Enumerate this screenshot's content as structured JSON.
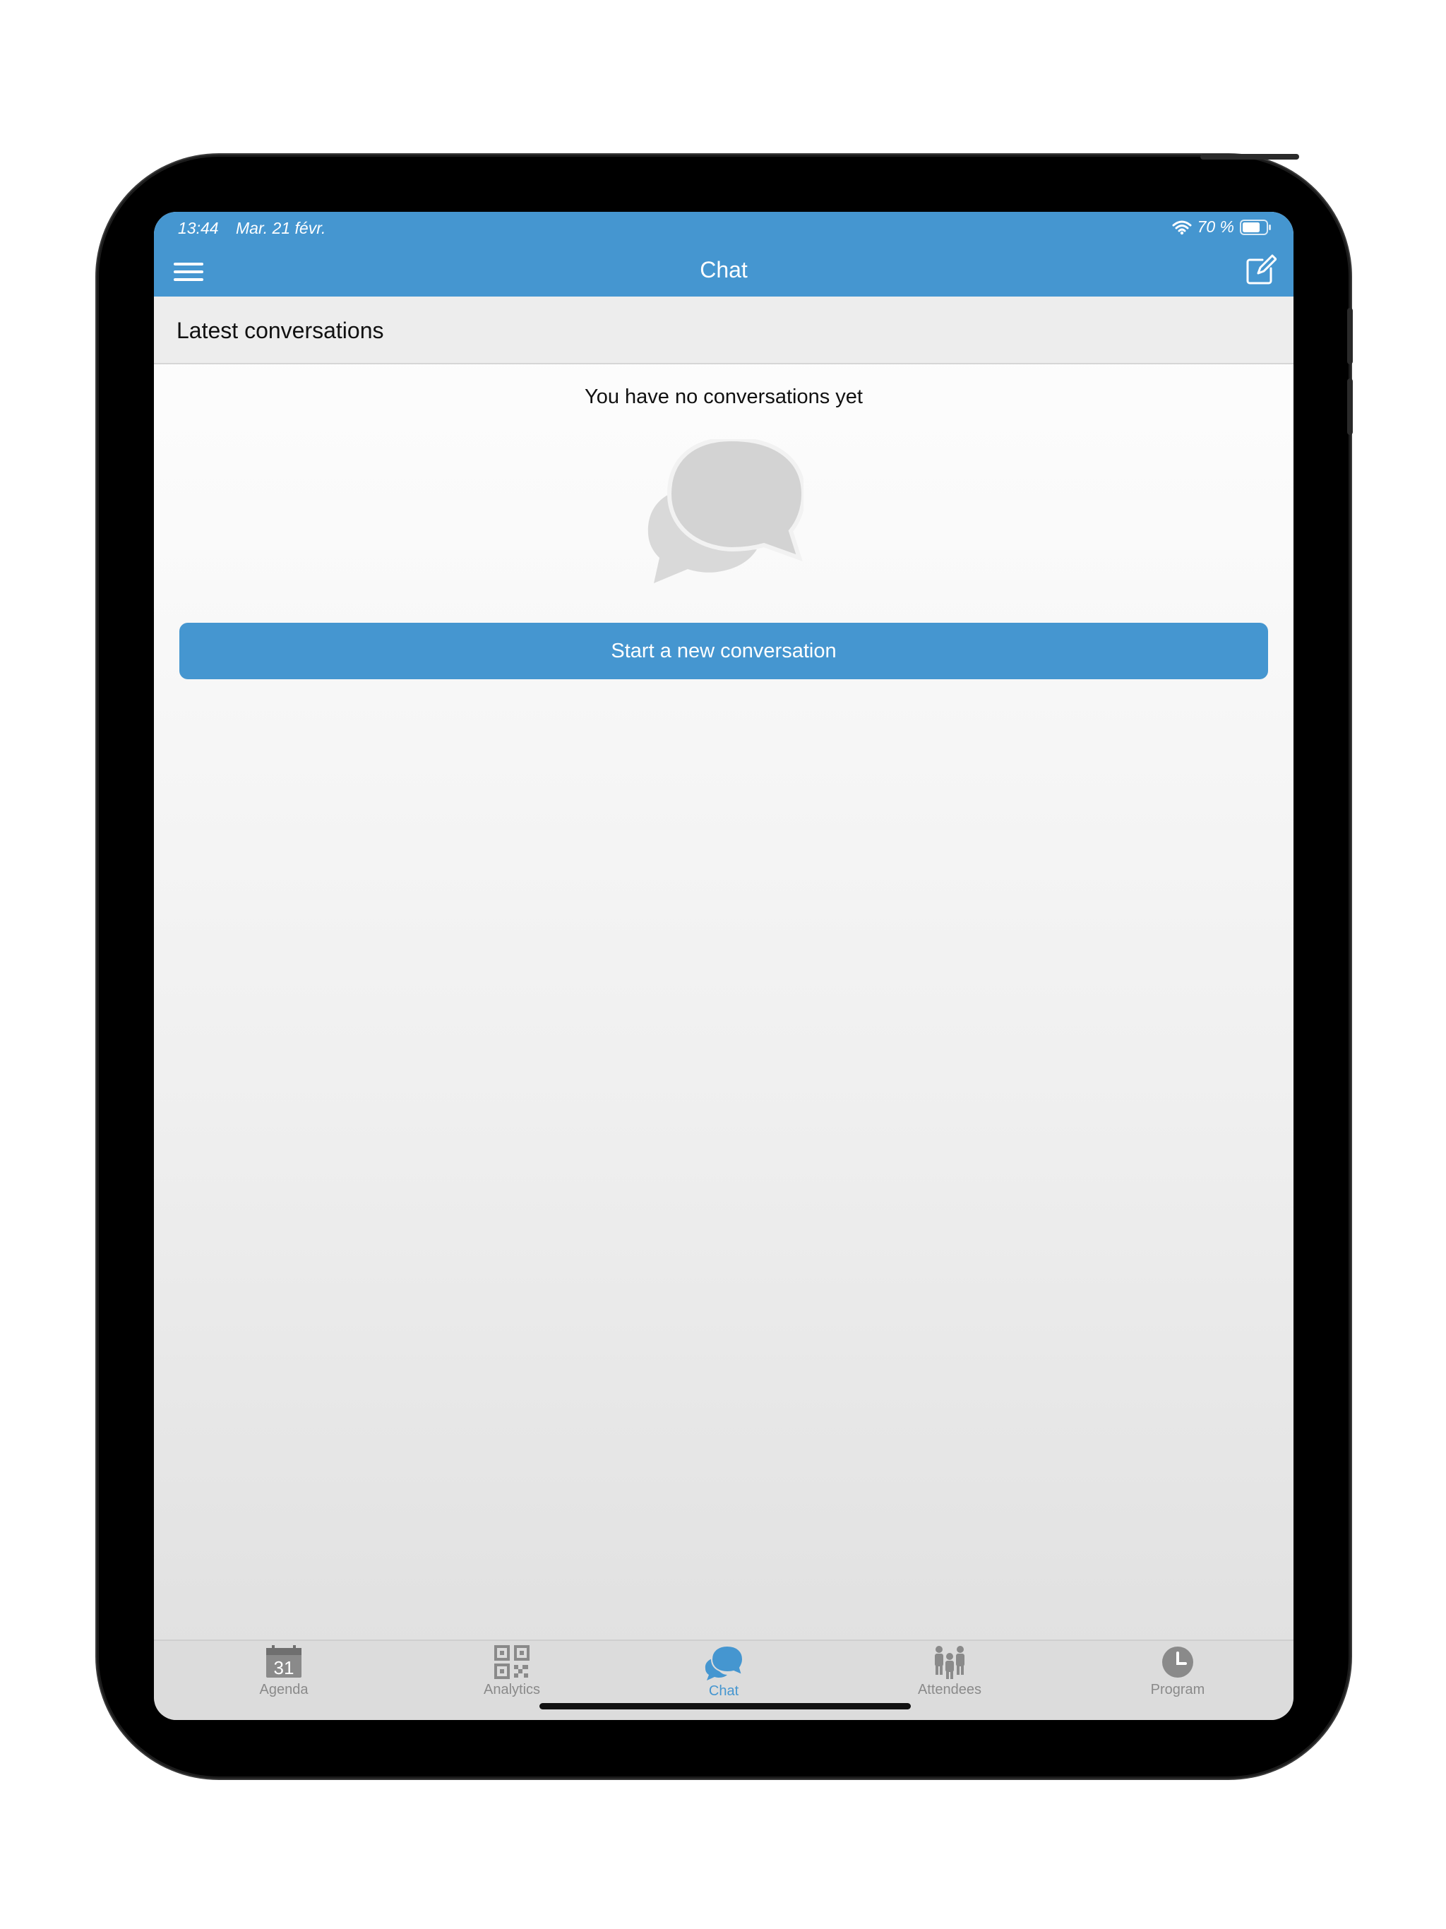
{
  "status_bar": {
    "time": "13:44",
    "date": "Mar. 21 févr.",
    "battery": "70 %",
    "wifi_icon": "wifi-icon",
    "battery_icon": "battery-icon"
  },
  "nav": {
    "title": "Chat",
    "menu_icon": "hamburger-menu-icon",
    "compose_icon": "compose-icon"
  },
  "section": {
    "title": "Latest conversations"
  },
  "empty_state": {
    "message": "You have no conversations yet",
    "icon": "chat-bubbles-icon"
  },
  "start_button": {
    "label": "Start a new conversation"
  },
  "tabs": [
    {
      "label": "Agenda",
      "icon": "calendar-icon",
      "calendar_day": "31",
      "active": false
    },
    {
      "label": "Analytics",
      "icon": "qr-code-icon",
      "active": false
    },
    {
      "label": "Chat",
      "icon": "chat-icon",
      "active": true
    },
    {
      "label": "Attendees",
      "icon": "people-icon",
      "active": false
    },
    {
      "label": "Program",
      "icon": "clock-icon",
      "active": false
    }
  ],
  "colors": {
    "accent": "#4596d0",
    "tab_inactive": "#8a8a8a",
    "header_bg": "#ededed",
    "bubble_gray": "#d6d6d6"
  }
}
